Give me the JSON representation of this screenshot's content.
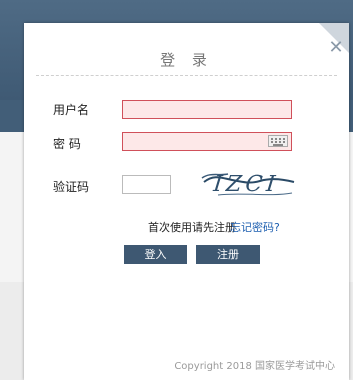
{
  "dialog": {
    "title": "登 录",
    "username_label": "用户名",
    "password_label": "密 码",
    "captcha_label": "验证码",
    "captcha_text": "IZCI",
    "register_tip": "首次使用请先注册",
    "forgot_link": "忘记密码?",
    "login_button": "登入",
    "register_button": "注册",
    "copyright": "Copyright 2018 国家医学考试中心"
  },
  "colors": {
    "accent": "#3e5872",
    "input_error_bg": "#fde8e8",
    "input_error_border": "#d0505a",
    "link": "#1e5fb0"
  }
}
